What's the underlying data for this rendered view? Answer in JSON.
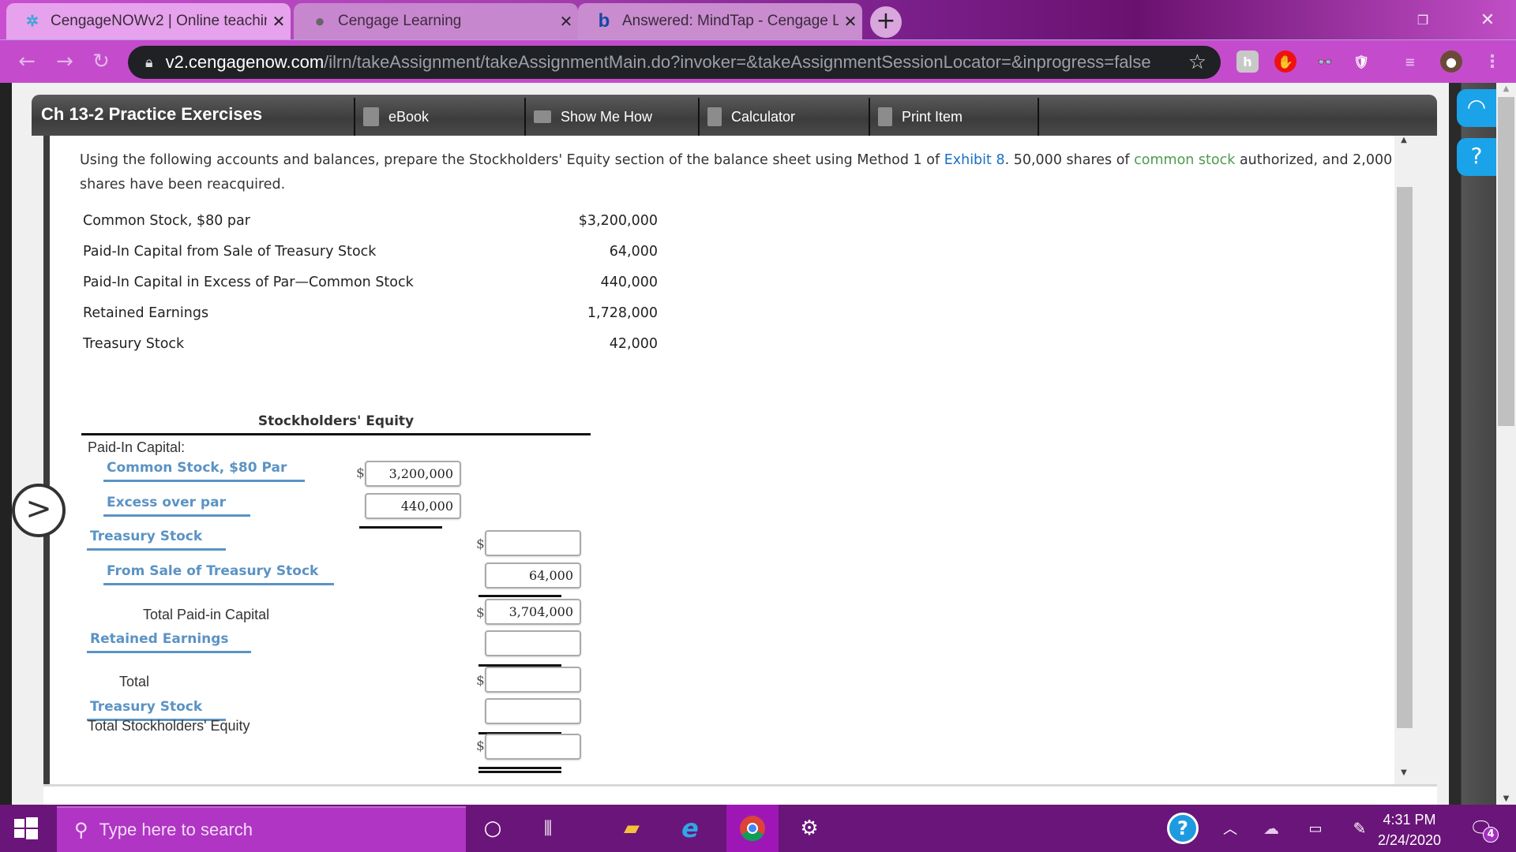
{
  "browser": {
    "tabs": [
      {
        "title": "CengageNOWv2 | Online teachin",
        "icon": "cengage-icon",
        "active": true
      },
      {
        "title": "Cengage Learning",
        "icon": "globe-icon",
        "active": false
      },
      {
        "title": "Answered: MindTap - Cengage L",
        "icon": "bartleby-b-icon",
        "active": false
      }
    ],
    "new_tab": "+",
    "url_host": "v2.cengagenow.com",
    "url_path": "/ilrn/takeAssignment/takeAssignmentMain.do?invoker=&takeAssignmentSessionLocator=&inprogress=false",
    "icons": {
      "back": "←",
      "forward": "→",
      "reload": "↻",
      "lock": "🔒",
      "star": "☆",
      "minimize": "—",
      "restore": "❐",
      "close": "✕",
      "menu": "⋮"
    }
  },
  "assignment": {
    "title": "Ch 13-2 Practice Exercises",
    "toolbar": [
      {
        "label": "eBook",
        "icon": "book-icon"
      },
      {
        "label": "Show Me How",
        "icon": "video-icon"
      },
      {
        "label": "Calculator",
        "icon": "calculator-icon"
      },
      {
        "label": "Print Item",
        "icon": "print-icon"
      }
    ],
    "prompt": {
      "before": "Using the following accounts and balances, prepare the Stockholders' Equity section of the balance sheet using Method 1 of ",
      "link": "Exhibit 8",
      "middle": ". 50,000 shares of ",
      "gloss": "common stock",
      "after": " authorized, and 2,000 shares have been reacquired."
    },
    "accounts": [
      {
        "name": "Common Stock, $80 par",
        "value": "$3,200,000"
      },
      {
        "name": "Paid-In Capital from Sale of Treasury Stock",
        "value": "64,000"
      },
      {
        "name": "Paid-In Capital in Excess of Par—Common Stock",
        "value": "440,000"
      },
      {
        "name": "Retained Earnings",
        "value": "1,728,000"
      },
      {
        "name": "Treasury Stock",
        "value": "42,000"
      }
    ],
    "equity": {
      "heading": "Stockholders' Equity",
      "paid_in_capital_label": "Paid-In Capital:",
      "rows": {
        "common_stock": {
          "label": "Common Stock, $80 Par",
          "value": "3,200,000"
        },
        "excess_over_par": {
          "label": "Excess over par",
          "value": "440,000"
        },
        "treasury_stock_pic": {
          "label": "Treasury Stock",
          "value": ""
        },
        "from_sale_treasury": {
          "label": "From Sale of Treasury Stock",
          "value": "64,000"
        },
        "total_paid_in": {
          "label": "Total Paid-in Capital",
          "value": "3,704,000"
        },
        "retained_earnings": {
          "label": "Retained Earnings",
          "value": ""
        },
        "total": {
          "label": "Total",
          "value": ""
        },
        "treasury_stock": {
          "label": "Treasury Stock",
          "value": ""
        },
        "total_equity": {
          "label": "Total Stockholders' Equity",
          "value": ""
        }
      },
      "currency": "$"
    },
    "side_arrow": ">"
  },
  "rail": {
    "support_icon": "headset-icon",
    "help_label": "?"
  },
  "taskbar": {
    "search_placeholder": "Type here to search",
    "time": "4:31 PM",
    "date": "2/24/2020",
    "notification_count": "4"
  }
}
